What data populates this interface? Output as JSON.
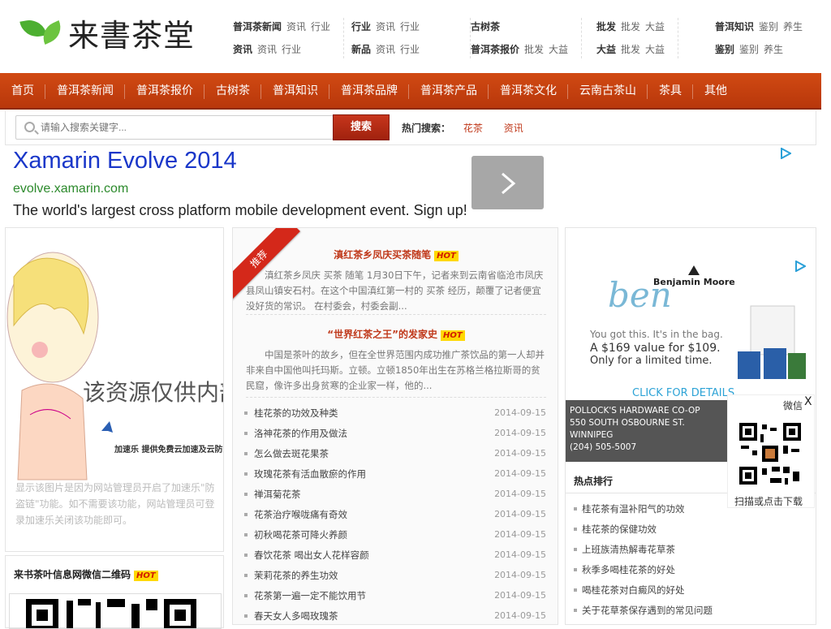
{
  "header": {
    "logo_text": "来書茶堂",
    "groups": [
      {
        "rows": [
          {
            "title": "普洱茶新闻",
            "items": [
              "资讯",
              "行业"
            ]
          },
          {
            "title": "资讯",
            "items": [
              "资讯",
              "行业"
            ]
          }
        ]
      },
      {
        "rows": [
          {
            "title": "行业",
            "items": [
              "资讯",
              "行业"
            ]
          },
          {
            "title": "新品",
            "items": [
              "资讯",
              "行业"
            ]
          }
        ]
      },
      {
        "rows": [
          {
            "title": "古树茶",
            "items": []
          },
          {
            "title": "普洱茶报价",
            "items": [
              "批发",
              "大益"
            ]
          }
        ]
      },
      {
        "rows": [
          {
            "title": "批发",
            "items": [
              "批发",
              "大益"
            ]
          },
          {
            "title": "大益",
            "items": [
              "批发",
              "大益"
            ]
          }
        ]
      },
      {
        "rows": [
          {
            "title": "普洱知识",
            "items": [
              "鉴别",
              "养生"
            ]
          },
          {
            "title": "鉴别",
            "items": [
              "鉴别",
              "养生"
            ]
          }
        ]
      }
    ]
  },
  "nav": {
    "items": [
      "首页",
      "普洱茶新闻",
      "普洱茶报价",
      "古树茶",
      "普洱知识",
      "普洱茶品牌",
      "普洱茶产品",
      "普洱茶文化",
      "云南古茶山",
      "茶具",
      "其他"
    ]
  },
  "search": {
    "placeholder": "请输入搜索关键字...",
    "button": "搜索",
    "hot_label": "热门搜索：",
    "hot_terms": [
      "花茶",
      "资讯"
    ]
  },
  "ad": {
    "title": "Xamarin Evolve 2014",
    "url": "evolve.xamarin.com",
    "description": "The world's largest cross platform mobile development event. Sign up!"
  },
  "left": {
    "image_caption": "该资源仅供内部交流",
    "image_subcaption": "加速乐 提供免费云加速及云防火墙服务",
    "image_note": "显示该图片是因为网站管理员开启了加速乐\"防盗链\"功能。如不需要该功能，网站管理员可登录加速乐关闭该功能即可。",
    "qr_title": "来书茶叶信息网微信二维码",
    "hot_badge": "HOT"
  },
  "middle": {
    "ribbon": "推荐",
    "features": [
      {
        "title": "滇红茶乡凤庆买茶随笔",
        "badge": "HOT",
        "desc": "滇红茶乡凤庆 买茶 随笔 1月30日下午，记者来到云南省临沧市凤庆县凤山镇安石村。在这个中国滇红第一村的 买茶 经历，颠覆了记者便宜没好货的常识。 在村委会，村委会副..."
      },
      {
        "title": "“世界红茶之王”的发家史",
        "badge": "HOT",
        "desc": "中国是茶叶的故乡，但在全世界范围内成功推广茶饮品的第一人却并非来自中国他叫托玛斯。立顿。立顿1850年出生在苏格兰格拉斯哥的贫民窟，像许多出身贫寒的企业家一样，他的..."
      }
    ],
    "news": [
      {
        "title": "桂花茶的功效及种类",
        "date": "2014-09-15"
      },
      {
        "title": "洛神花茶的作用及做法",
        "date": "2014-09-15"
      },
      {
        "title": "怎么做去斑花果茶",
        "date": "2014-09-15"
      },
      {
        "title": "玫瑰花茶有活血散瘀的作用",
        "date": "2014-09-15"
      },
      {
        "title": "禅洱菊花茶",
        "date": "2014-09-15"
      },
      {
        "title": "花茶治疗喉咙痛有奇效",
        "date": "2014-09-15"
      },
      {
        "title": "初秋喝花茶可降火养颜",
        "date": "2014-09-15"
      },
      {
        "title": "春饮花茶 喝出女人花样容颜",
        "date": "2014-09-15"
      },
      {
        "title": "茉莉花茶的养生功效",
        "date": "2014-09-15"
      },
      {
        "title": "花茶第一遍一定不能饮用节",
        "date": "2014-09-15"
      },
      {
        "title": "春天女人多喝玫瑰茶",
        "date": "2014-09-15"
      }
    ]
  },
  "right": {
    "ad_brand": "Benjamin Moore",
    "ad_ben": "ben",
    "ad_line1": "You got this. It's in the bag.",
    "ad_line2": "A $169 value for $109.",
    "ad_line3": "Only for a limited time.",
    "ad_cta": "CLICK FOR DETAILS",
    "store_lines": [
      "POLLOCK'S HARDWARE CO-OP",
      "550 SOUTH OSBOURNE ST.",
      "WINNIPEG",
      "(204) 505-5007"
    ],
    "hot_rank_title": "热点排行",
    "rank": [
      "桂花茶有温补阳气的功效",
      "桂花茶的保健功效",
      "上班族清热解毒花草茶",
      "秋季多喝桂花茶的好处",
      "喝桂花茶对白癜风的好处",
      "关于花草茶保存遇到的常见问题"
    ]
  },
  "wechat": {
    "label": "微信",
    "close": "X",
    "download": "扫描或点击下载"
  },
  "colors": {
    "nav_red": "#c0400f",
    "accent_red": "#c0391b",
    "link_blue": "#1a37c9",
    "url_green": "#2c8a2c"
  }
}
